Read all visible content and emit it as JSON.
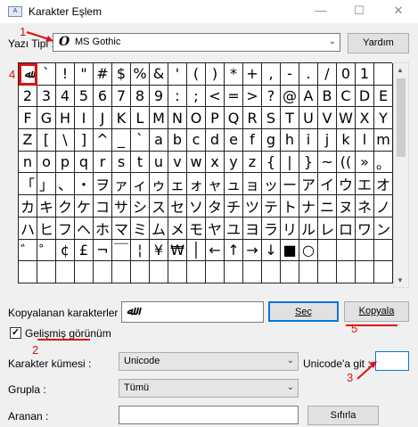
{
  "window": {
    "title": "Karakter Eşlem",
    "minimize": "—",
    "maximize": "☐",
    "close": "✕"
  },
  "font_row": {
    "label": "Yazı Tipi :",
    "font_name": "MS Gothic",
    "font_icon": "O",
    "help_button": "Yardım"
  },
  "grid": {
    "cells": [
      "ﷲ",
      "`",
      "!",
      "\"",
      "#",
      "$",
      "%",
      "&",
      "'",
      "(",
      ")",
      "*",
      "+",
      ",",
      "-",
      ".",
      "/",
      "0",
      "1",
      "",
      "2",
      "3",
      "4",
      "5",
      "6",
      "7",
      "8",
      "9",
      ":",
      ";",
      "<",
      "=",
      ">",
      "?",
      "@",
      "A",
      "B",
      "C",
      "D",
      "E",
      "F",
      "G",
      "H",
      "I",
      "J",
      "K",
      "L",
      "M",
      "N",
      "O",
      "P",
      "Q",
      "R",
      "S",
      "T",
      "U",
      "V",
      "W",
      "X",
      "Y",
      "Z",
      "[",
      "\\",
      "]",
      "^",
      "_",
      "`",
      "a",
      "b",
      "c",
      "d",
      "e",
      "f",
      "g",
      "h",
      "i",
      "j",
      "k",
      "l",
      "m",
      "n",
      "o",
      "p",
      "q",
      "r",
      "s",
      "t",
      "u",
      "v",
      "w",
      "x",
      "y",
      "z",
      "{",
      "|",
      "}",
      "~",
      "(( ",
      "»",
      "。",
      "「",
      "」",
      "、",
      "・",
      "ヲ",
      "ァ",
      "ィ",
      "ゥ",
      "ェ",
      "ォ",
      "ャ",
      "ュ",
      "ョ",
      "ッ",
      "ー",
      "ア",
      "イ",
      "ウ",
      "エ",
      "オ",
      "カ",
      "キ",
      "ク",
      "ケ",
      "コ",
      "サ",
      "シ",
      "ス",
      "セ",
      "ソ",
      "タ",
      "チ",
      "ツ",
      "テ",
      "ト",
      "ナ",
      "ニ",
      "ヌ",
      "ネ",
      "ノ",
      "ハ",
      "ヒ",
      "フ",
      "ヘ",
      "ホ",
      "マ",
      "ミ",
      "ム",
      "メ",
      "モ",
      "ヤ",
      "ユ",
      "ヨ",
      "ラ",
      "リ",
      "ル",
      "レ",
      "ロ",
      "ワ",
      "ン",
      "゛",
      "゜",
      "¢",
      "£",
      "¬",
      "￣",
      "¦",
      "¥",
      "₩",
      "│",
      "←",
      "↑",
      "→",
      "↓",
      "■",
      "○",
      "",
      "",
      "",
      "",
      "",
      "",
      "",
      "",
      "",
      "",
      "",
      "",
      "",
      "",
      "",
      "",
      "",
      "",
      "",
      "",
      "",
      "",
      "",
      ""
    ]
  },
  "copy_row": {
    "label": "Kopyalanan karakterler :",
    "value": "ﷲ",
    "select_button": "Seç",
    "copy_button": "Kopyala"
  },
  "advanced": {
    "label": "Gelişmiş görünüm",
    "checked": "✓"
  },
  "charset": {
    "label": "Karakter kümesi :",
    "value": "Unicode"
  },
  "unicode_goto": {
    "label": "Unicode'a git :",
    "value": ""
  },
  "group": {
    "label": "Grupla :",
    "value": "Tümü"
  },
  "search": {
    "label": "Aranan :",
    "value": "",
    "reset_button": "Sıfırla"
  },
  "annotations": {
    "n1": "1",
    "n2": "2",
    "n3": "3",
    "n4": "4",
    "n5": "5",
    "color": "#e01010"
  }
}
